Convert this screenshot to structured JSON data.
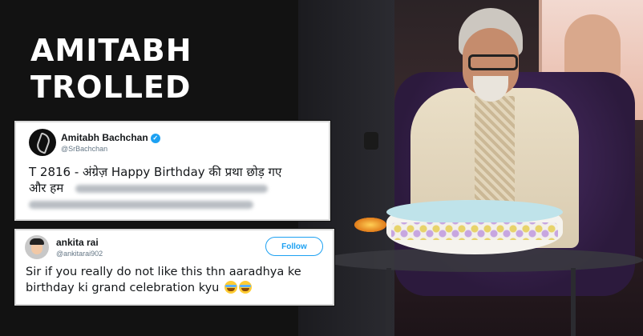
{
  "headline": {
    "line1": "AMITABH",
    "line2": "TROLLED"
  },
  "tweet_1": {
    "display_name": "Amitabh Bachchan",
    "verified_icon": "verified-badge-icon",
    "handle": "@SrBachchan",
    "text_line1": "T 2816 - अंग्रेज़ Happy Birthday की प्रथा छोड़ गए",
    "text_line2": "और हम"
  },
  "tweet_2": {
    "display_name": "ankita rai",
    "handle": "@ankitarai902",
    "follow_label": "Follow",
    "text": "Sir if you really do not like this thn aaradhya ke birthday ki grand celebration kyu",
    "emoji": [
      "face-with-tears-of-joy-icon",
      "face-with-tears-of-joy-icon"
    ]
  },
  "colors": {
    "background": "#121212",
    "headline_text": "#ffffff",
    "twitter_blue": "#1da1f2"
  }
}
